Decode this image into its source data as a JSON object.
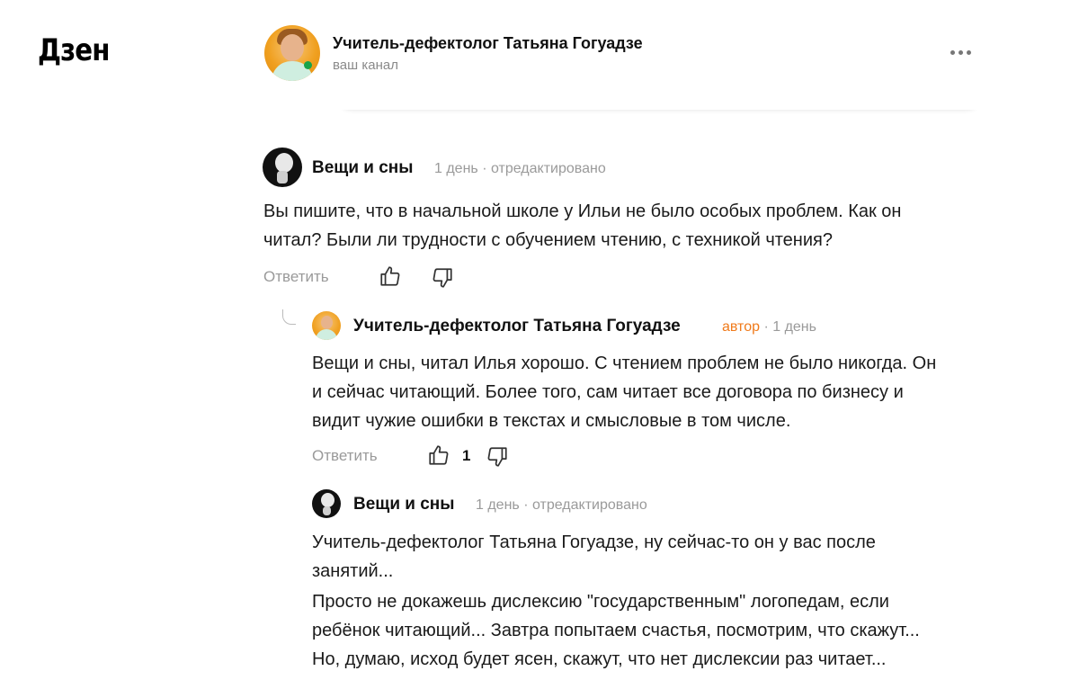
{
  "app": {
    "logo": "Дзен"
  },
  "channel": {
    "title": "Учитель-дефектолог Татьяна Гогуадзе",
    "subtitle": "ваш канал",
    "more_icon": "more-dots-icon"
  },
  "comments": [
    {
      "author": "Вещи и сны",
      "meta": "1 день · отредактировано",
      "text_lines": [
        "Вы пишите, что в начальной школе у Ильи не было особых проблем. Как он",
        "читал? Были ли трудности с обучением чтению, с техникой чтения?"
      ],
      "reply_label": "Ответить",
      "like_icon": "thumbs-up-icon",
      "dislike_icon": "thumbs-down-icon"
    },
    {
      "author": "Учитель-дефектолог Татьяна Гогуадзе",
      "badge": "автор",
      "meta": "· 1 день",
      "text_lines": [
        "Вещи и сны, читал Илья хорошо. С чтением проблем не было никогда. Он",
        "и сейчас читающий. Более того, сам читает все договора по бизнесу и",
        "видит чужие ошибки в текстах и смысловые в том числе."
      ],
      "reply_label": "Ответить",
      "likes": "1",
      "like_icon": "thumbs-up-icon",
      "dislike_icon": "thumbs-down-icon"
    },
    {
      "author": "Вещи и сны",
      "meta": "1 день · отредактировано",
      "paragraph1": [
        "Учитель-дефектолог Татьяна Гогуадзе, ну сейчас-то он у вас после",
        "занятий..."
      ],
      "paragraph2": [
        "Просто не докажешь дислексию \"государственным\" логопедам, если",
        "ребёнок читающий... Завтра попытаем счастья, посмотрим, что скажут...",
        "Но, думаю, исход будет ясен, скажут, что нет дислексии раз читает..."
      ]
    }
  ],
  "colors": {
    "accent_author": "#f07a1a",
    "muted": "#9a9a9a"
  }
}
